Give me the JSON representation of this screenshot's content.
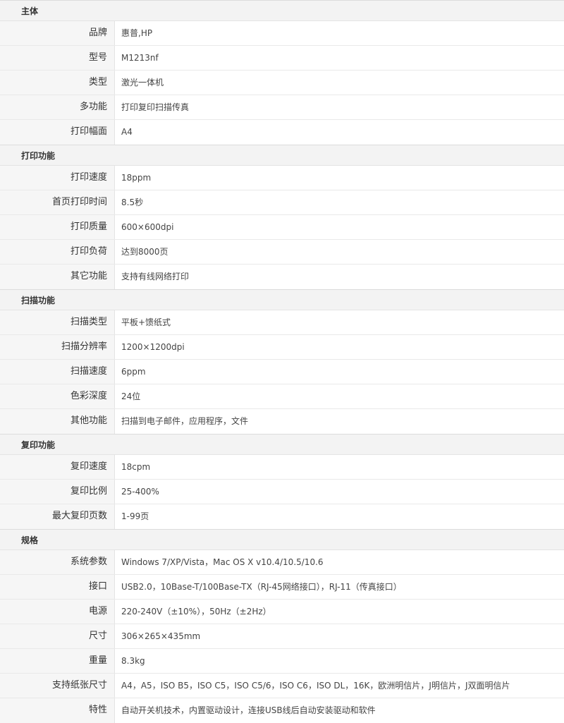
{
  "sections": [
    {
      "title": "主体",
      "rows": [
        {
          "label": "品牌",
          "value": "惠普,HP"
        },
        {
          "label": "型号",
          "value": "M1213nf"
        },
        {
          "label": "类型",
          "value": "激光一体机"
        },
        {
          "label": "多功能",
          "value": "打印复印扫描传真"
        },
        {
          "label": "打印幅面",
          "value": "A4"
        }
      ]
    },
    {
      "title": "打印功能",
      "rows": [
        {
          "label": "打印速度",
          "value": "18ppm"
        },
        {
          "label": "首页打印时间",
          "value": "8.5秒"
        },
        {
          "label": "打印质量",
          "value": "600×600dpi"
        },
        {
          "label": "打印负荷",
          "value": "达到8000页"
        },
        {
          "label": "其它功能",
          "value": "支持有线网络打印"
        }
      ]
    },
    {
      "title": "扫描功能",
      "rows": [
        {
          "label": "扫描类型",
          "value": "平板+馈纸式"
        },
        {
          "label": "扫描分辨率",
          "value": "1200×1200dpi"
        },
        {
          "label": "扫描速度",
          "value": "6ppm"
        },
        {
          "label": "色彩深度",
          "value": "24位"
        },
        {
          "label": "其他功能",
          "value": "扫描到电子邮件，应用程序，文件"
        }
      ]
    },
    {
      "title": "复印功能",
      "rows": [
        {
          "label": "复印速度",
          "value": "18cpm"
        },
        {
          "label": "复印比例",
          "value": "25-400%"
        },
        {
          "label": "最大复印页数",
          "value": "1-99页"
        }
      ]
    },
    {
      "title": "规格",
      "rows": [
        {
          "label": "系统参数",
          "value": "Windows 7/XP/Vista，Mac OS X v10.4/10.5/10.6"
        },
        {
          "label": "接口",
          "value": "USB2.0，10Base-T/100Base-TX（RJ-45网络接口），RJ-11（传真接口）"
        },
        {
          "label": "电源",
          "value": "220-240V（±10%），50Hz（±2Hz）"
        },
        {
          "label": "尺寸",
          "value": "306×265×435mm"
        },
        {
          "label": "重量",
          "value": "8.3kg"
        },
        {
          "label": "支持纸张尺寸",
          "value": "A4，A5，ISO B5，ISO C5，ISO C5/6，ISO C6，ISO DL，16K，欧洲明信片，J明信片，J双面明信片"
        },
        {
          "label": "特性",
          "value": "自动开关机技术，内置驱动设计，连接USB线后自动安装驱动和软件"
        }
      ]
    }
  ]
}
